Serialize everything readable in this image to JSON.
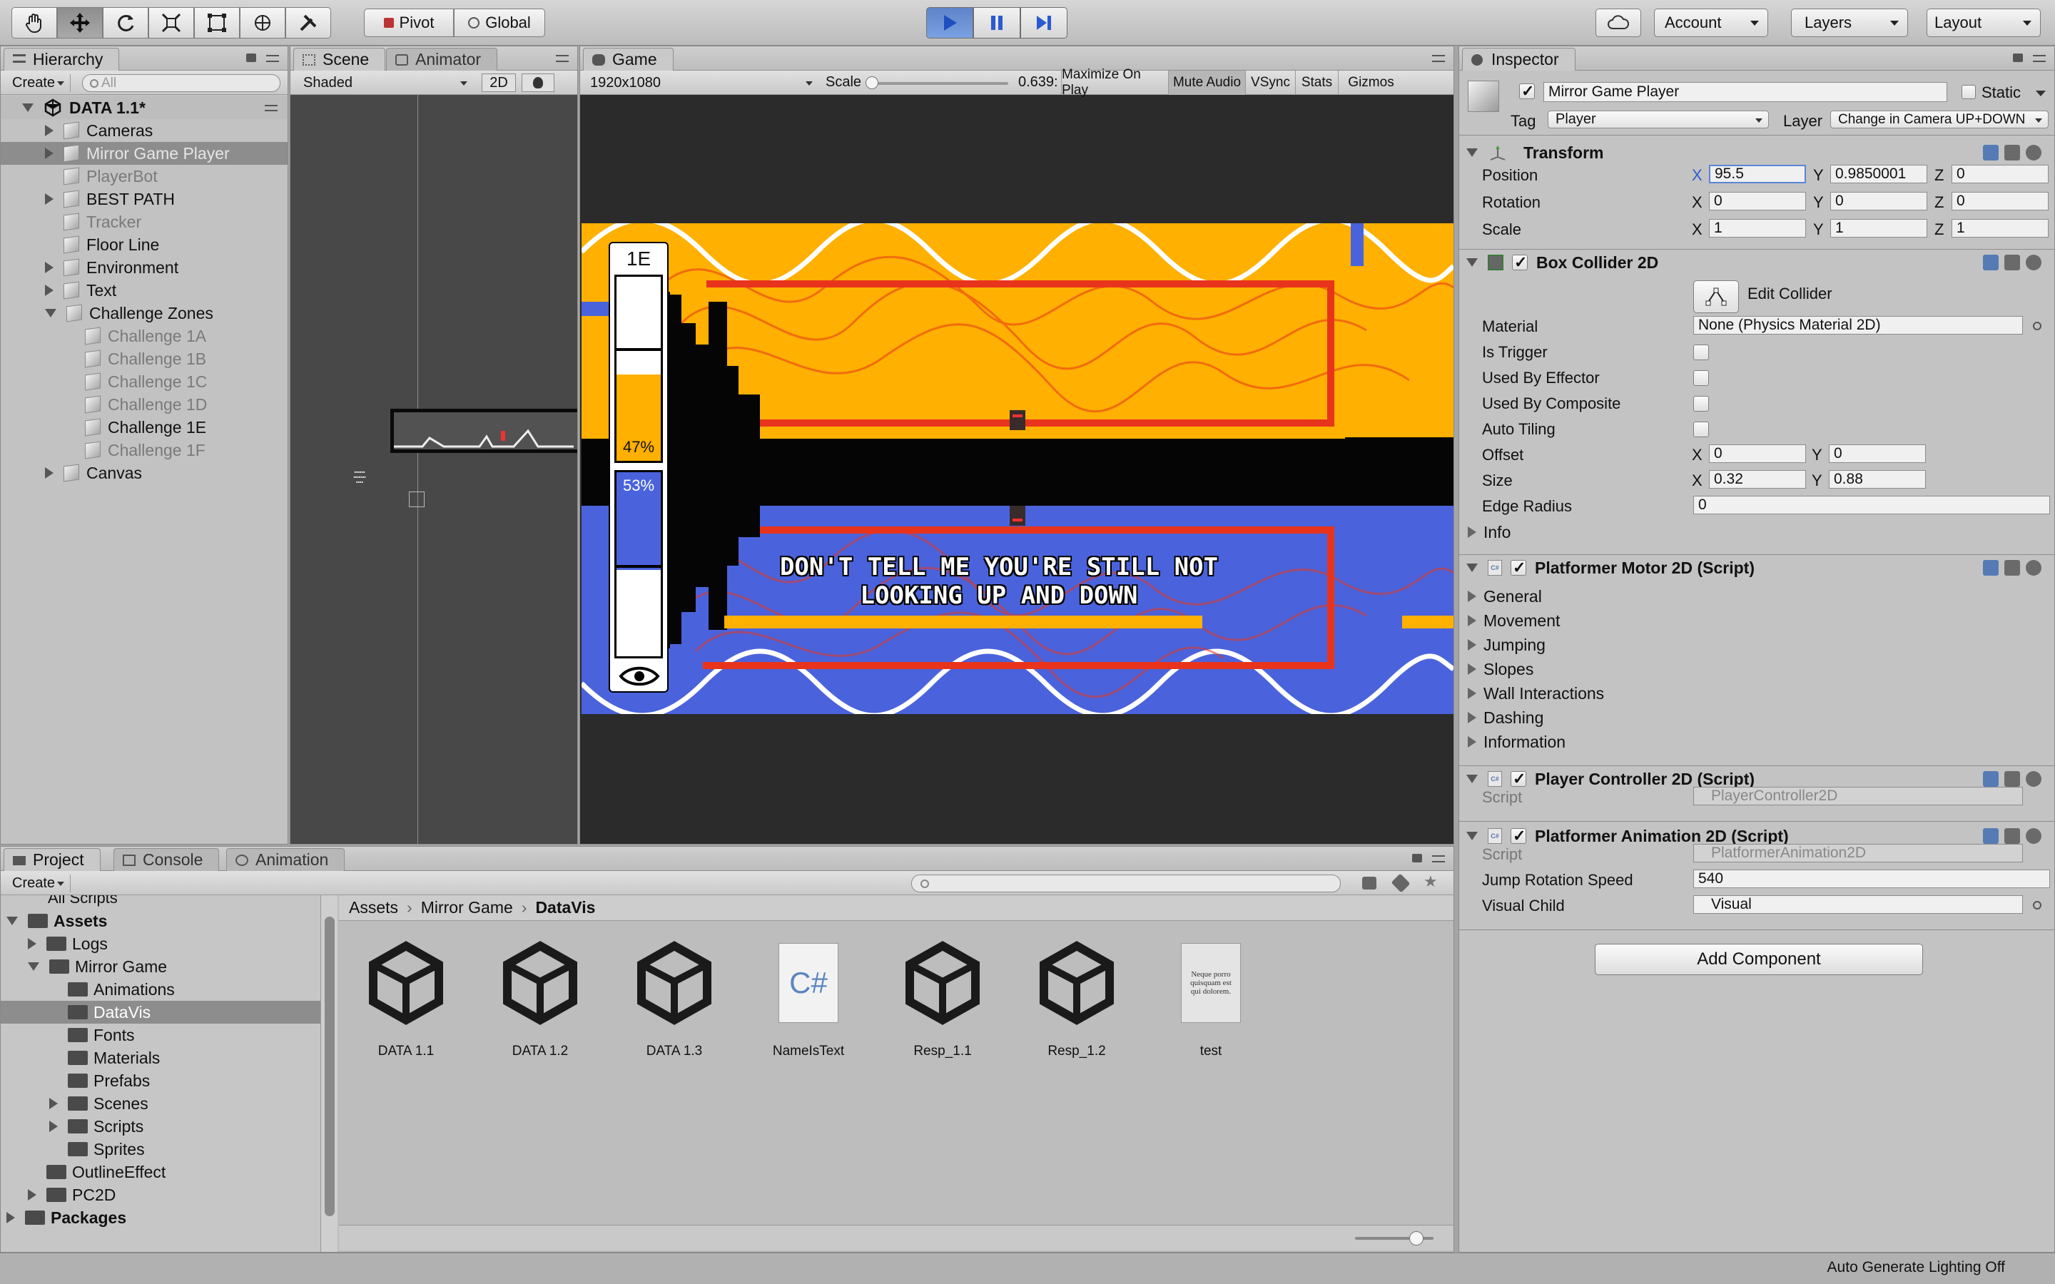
{
  "toolbar": {
    "tools": [
      "hand-tool-icon",
      "move-tool-icon",
      "rotate-tool-icon",
      "scale-tool-icon",
      "rect-tool-icon",
      "transform-tool-icon",
      "custom-tool-icon"
    ],
    "pivot_label": "Pivot",
    "global_label": "Global",
    "account_label": "Account",
    "layers_label": "Layers",
    "layout_label": "Layout"
  },
  "hierarchy": {
    "tab": "Hierarchy",
    "create_label": "Create",
    "search_placeholder": "All",
    "scene_name": "DATA 1.1*",
    "items": [
      {
        "label": "Cameras",
        "indent": 1,
        "expandable": true,
        "dim": false
      },
      {
        "label": "Mirror Game Player",
        "indent": 1,
        "expandable": true,
        "dim": true,
        "selected": true
      },
      {
        "label": "PlayerBot",
        "indent": 1,
        "expandable": false,
        "dim": true
      },
      {
        "label": "BEST PATH",
        "indent": 1,
        "expandable": true,
        "dim": false
      },
      {
        "label": "Tracker",
        "indent": 1,
        "expandable": false,
        "dim": true
      },
      {
        "label": "Floor Line",
        "indent": 1,
        "expandable": false,
        "dim": false
      },
      {
        "label": "Environment",
        "indent": 1,
        "expandable": true,
        "dim": false
      },
      {
        "label": "Text",
        "indent": 1,
        "expandable": true,
        "dim": false
      },
      {
        "label": "Challenge Zones",
        "indent": 1,
        "expandable": true,
        "expanded": true,
        "dim": false
      },
      {
        "label": "Challenge 1A",
        "indent": 2,
        "expandable": false,
        "dim": true
      },
      {
        "label": "Challenge 1B",
        "indent": 2,
        "expandable": false,
        "dim": true
      },
      {
        "label": "Challenge 1C",
        "indent": 2,
        "expandable": false,
        "dim": true
      },
      {
        "label": "Challenge 1D",
        "indent": 2,
        "expandable": false,
        "dim": true
      },
      {
        "label": "Challenge 1E",
        "indent": 2,
        "expandable": false,
        "dim": false
      },
      {
        "label": "Challenge 1F",
        "indent": 2,
        "expandable": false,
        "dim": true
      },
      {
        "label": "Canvas",
        "indent": 1,
        "expandable": true,
        "dim": false
      }
    ]
  },
  "scene": {
    "tab_scene": "Scene",
    "tab_animator": "Animator",
    "shading": "Shaded",
    "mode_2d": "2D"
  },
  "game": {
    "tab": "Game",
    "resolution": "1920x1080",
    "scale_label": "Scale",
    "scale_value": "0.639:",
    "maximize_label": "Maximize On Play",
    "mute_label": "Mute Audio",
    "vsync_label": "VSync",
    "stats_label": "Stats",
    "gizmos_label": "Gizmos",
    "zone_label": "1E",
    "top_percent": "47%",
    "bottom_percent": "53%",
    "top_fill": 0.47,
    "bottom_fill": 0.53,
    "message_line1": "DON'T TELL ME YOU'RE STILL NOT",
    "message_line2": "LOOKING UP AND DOWN",
    "colors": {
      "top": "#ffb000",
      "bottom": "#4a63dc",
      "trail": "#e8341c"
    }
  },
  "project": {
    "tab_project": "Project",
    "tab_console": "Console",
    "tab_animation": "Animation",
    "create_label": "Create",
    "scrolled_item": "All Scripts",
    "tree": [
      {
        "label": "Assets",
        "indent": 0,
        "bold": true,
        "expanded": true
      },
      {
        "label": "Logs",
        "indent": 1,
        "expandable": true
      },
      {
        "label": "Mirror Game",
        "indent": 1,
        "expanded": true
      },
      {
        "label": "Animations",
        "indent": 2
      },
      {
        "label": "DataVis",
        "indent": 2,
        "selected": true
      },
      {
        "label": "Fonts",
        "indent": 2
      },
      {
        "label": "Materials",
        "indent": 2
      },
      {
        "label": "Prefabs",
        "indent": 2
      },
      {
        "label": "Scenes",
        "indent": 2,
        "expandable": true
      },
      {
        "label": "Scripts",
        "indent": 2,
        "expandable": true
      },
      {
        "label": "Sprites",
        "indent": 2
      },
      {
        "label": "OutlineEffect",
        "indent": 1
      },
      {
        "label": "PC2D",
        "indent": 1,
        "expandable": true
      },
      {
        "label": "Packages",
        "indent": 0,
        "bold": true,
        "expandable": true
      }
    ],
    "breadcrumb": [
      "Assets",
      "Mirror Game",
      "DataVis"
    ],
    "assets": [
      {
        "label": "DATA 1.1",
        "kind": "unity"
      },
      {
        "label": "DATA 1.2",
        "kind": "unity"
      },
      {
        "label": "DATA 1.3",
        "kind": "unity"
      },
      {
        "label": "NameIsText",
        "kind": "cs",
        "glyph": "C#"
      },
      {
        "label": "Resp_1.1",
        "kind": "unity"
      },
      {
        "label": "Resp_1.2",
        "kind": "unity"
      },
      {
        "label": "test",
        "kind": "text",
        "glyph": "Neque porro quisquam est qui dolorem."
      }
    ]
  },
  "inspector": {
    "tab": "Inspector",
    "object_name": "Mirror Game Player",
    "static_label": "Static",
    "tag_label": "Tag",
    "tag_value": "Player",
    "layer_label": "Layer",
    "layer_value": "Change in Camera UP+DOWN",
    "transform": {
      "title": "Transform",
      "rows": [
        {
          "label": "Position",
          "x": "95.5",
          "y": "0.9850001",
          "z": "0"
        },
        {
          "label": "Rotation",
          "x": "0",
          "y": "0",
          "z": "0"
        },
        {
          "label": "Scale",
          "x": "1",
          "y": "1",
          "z": "1"
        }
      ]
    },
    "box_collider": {
      "title": "Box Collider 2D",
      "edit_label": "Edit Collider",
      "material_label": "Material",
      "material_value": "None (Physics Material 2D)",
      "is_trigger": "Is Trigger",
      "used_by_effector": "Used By Effector",
      "used_by_composite": "Used By Composite",
      "auto_tiling": "Auto Tiling",
      "offset_label": "Offset",
      "offset_x": "0",
      "offset_y": "0",
      "size_label": "Size",
      "size_x": "0.32",
      "size_y": "0.88",
      "edge_radius_label": "Edge Radius",
      "edge_radius": "0",
      "info_label": "Info"
    },
    "motor": {
      "title": "Platformer Motor 2D (Script)",
      "sections": [
        "General",
        "Movement",
        "Jumping",
        "Slopes",
        "Wall Interactions",
        "Dashing",
        "Information"
      ]
    },
    "controller": {
      "title": "Player Controller 2D (Script)",
      "script_label": "Script",
      "script_value": "PlayerController2D"
    },
    "animation": {
      "title": "Platformer Animation 2D (Script)",
      "script_label": "Script",
      "script_value": "PlatformerAnimation2D",
      "jump_label": "Jump Rotation Speed",
      "jump_value": "540",
      "visual_label": "Visual Child",
      "visual_value": "Visual"
    },
    "add_component": "Add Component"
  },
  "status": {
    "text": "Auto Generate Lighting Off"
  }
}
